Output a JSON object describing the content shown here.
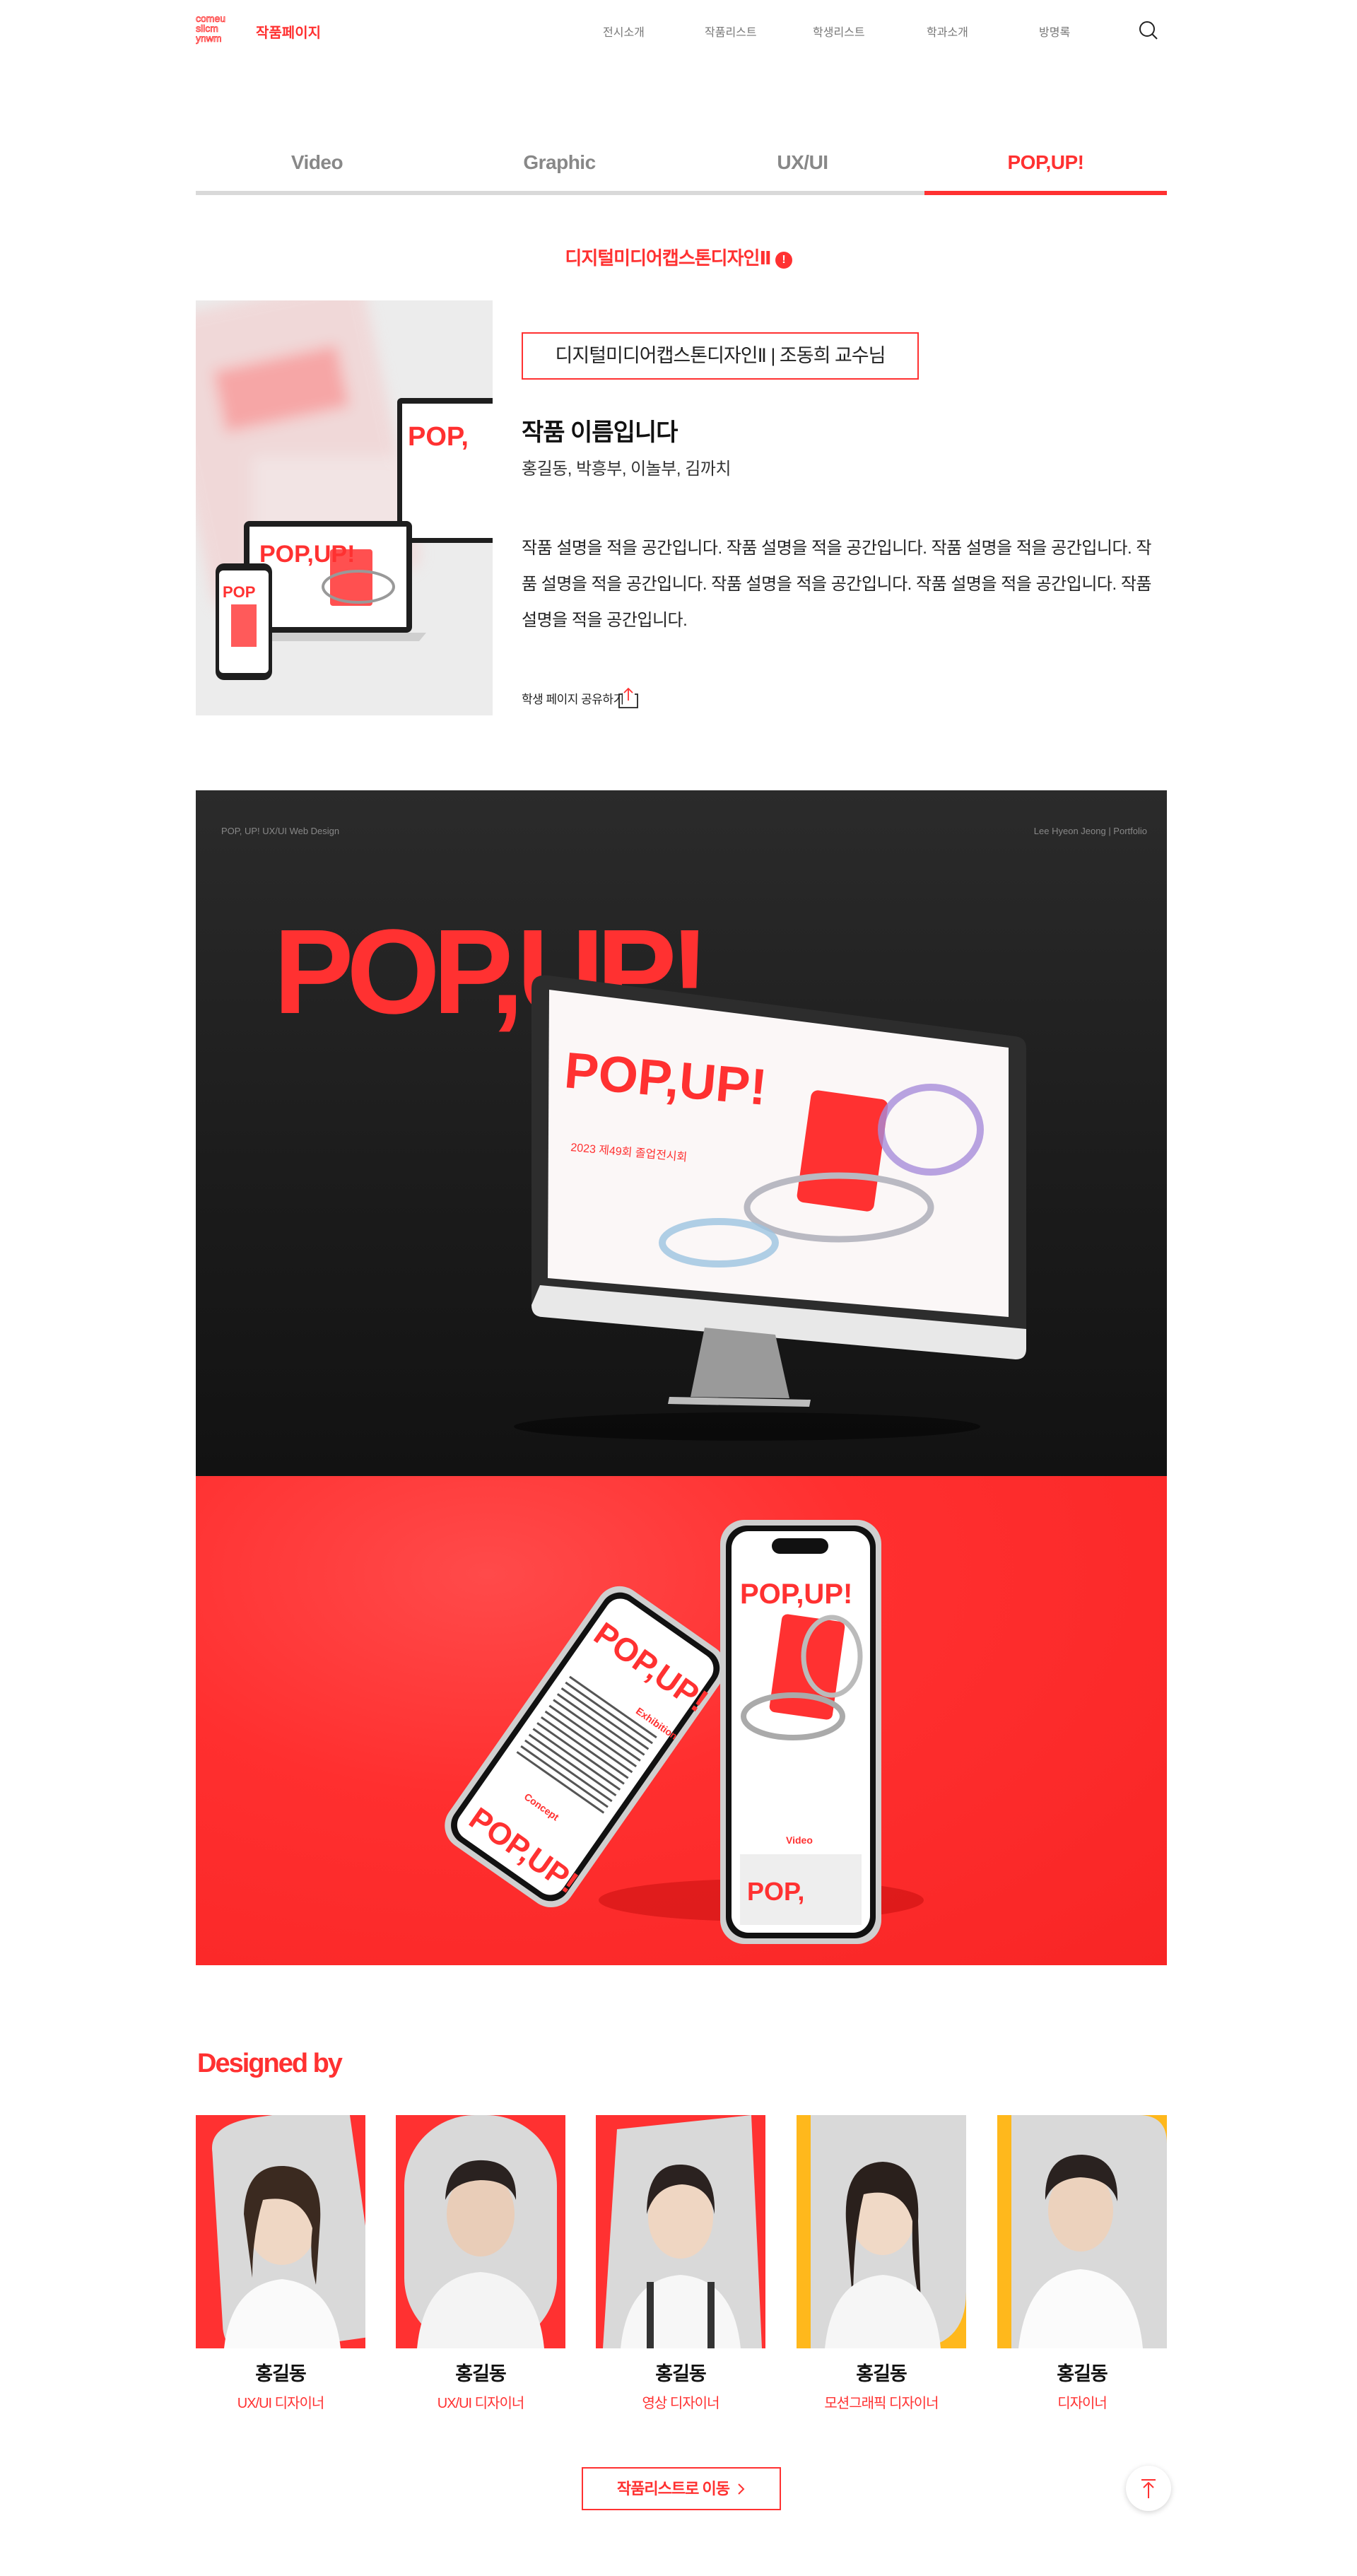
{
  "header": {
    "logo_text": "comeu",
    "brand_title": "작품페이지",
    "nav": [
      "전시소개",
      "작품리스트",
      "학생리스트",
      "학과소개",
      "방명록"
    ]
  },
  "tabs": [
    {
      "label": "Video",
      "active": false
    },
    {
      "label": "Graphic",
      "active": false
    },
    {
      "label": "UX/UI",
      "active": false
    },
    {
      "label": "POP,UP!",
      "active": true
    }
  ],
  "course_heading": "디지털미디어캡스톤디자인Ⅱ",
  "info_icon": "!",
  "work": {
    "course_box": "디지털미디어캡스톤디자인Ⅱ | 조동희 교수님",
    "title": "작품 이름입니다",
    "members": "홍길동, 박흥부, 이놀부, 김까치",
    "description": "작품 설명을 적을 공간입니다. 작품 설명을 적을 공간입니다. 작품 설명을 적을 공간입니다. 작품 설명을 적을 공간입니다. 작품 설명을 적을 공간입니다. 작품 설명을 적을 공간입니다. 작품 설명을 적을 공간입니다.",
    "share_label": "학생 페이지 공유하기"
  },
  "showcase": {
    "caption_left": "POP, UP! UX/UI Web Design",
    "caption_right": "Lee Hyeon Jeong | Portfolio",
    "logo_text": "POP,UP!",
    "screen_line1": "2023 제49회 졸업전시회",
    "phone_labels": [
      "Exhibition",
      "Concept",
      "Video"
    ]
  },
  "designed_by": "Designed by",
  "designers": [
    {
      "name": "홍길동",
      "role": "UX/UI 디자이너",
      "bg": "#ff3131"
    },
    {
      "name": "홍길동",
      "role": "UX/UI 디자이너",
      "bg": "#ff3131"
    },
    {
      "name": "홍길동",
      "role": "영상 디자이너",
      "bg": "#ff3131"
    },
    {
      "name": "홍길동",
      "role": "모션그래픽 디자이너",
      "bg": "#ffb81c"
    },
    {
      "name": "홍길동",
      "role": "디자이너",
      "bg": "#ffb81c"
    }
  ],
  "list_button": "작품리스트로 이동",
  "colors": {
    "accent": "#ff3131",
    "yellow": "#ffb81c",
    "dark": "#1c1c1c"
  }
}
